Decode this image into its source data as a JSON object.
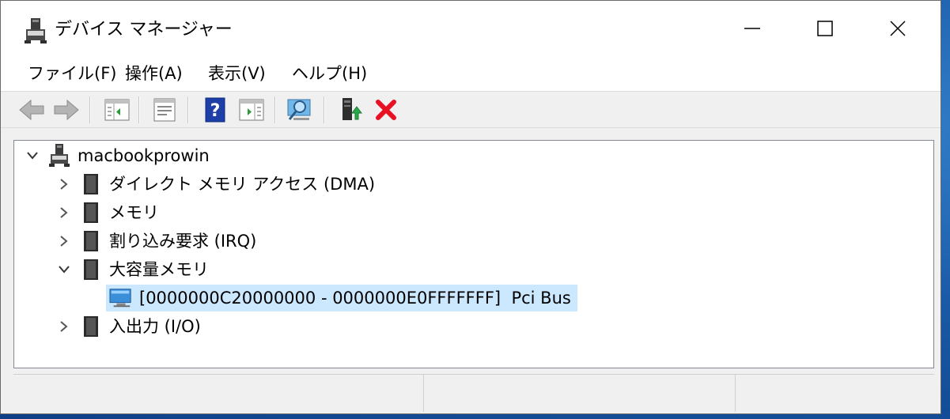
{
  "window": {
    "title": "デバイス マネージャー",
    "icon": "computer-icon"
  },
  "caption_buttons": {
    "minimize": "minimize-icon",
    "maximize": "maximize-icon",
    "close": "close-icon"
  },
  "menu": {
    "file": "ファイル(F)",
    "action": "操作(A)",
    "view": "表示(V)",
    "help": "ヘルプ(H)"
  },
  "toolbar": {
    "buttons": [
      "back-icon",
      "forward-icon",
      "show-hide-console-tree-icon",
      "properties-icon",
      "help-icon",
      "show-action-pane-icon",
      "scan-hardware-icon",
      "update-driver-icon",
      "uninstall-icon"
    ],
    "colors": {
      "uninstall_red": "#e81123",
      "help_blue": "#1e3fa8",
      "update_green": "#2aa84a"
    }
  },
  "tree": {
    "root": "macbookprowin",
    "items": [
      {
        "label": "ダイレクト メモリ アクセス (DMA)",
        "expanded": false
      },
      {
        "label": "メモリ",
        "expanded": false
      },
      {
        "label": "割り込み要求 (IRQ)",
        "expanded": false
      },
      {
        "label": "大容量メモリ",
        "expanded": true
      },
      {
        "label": "[0000000C20000000 - 0000000E0FFFFFFF]  Pci Bus",
        "selected": true
      },
      {
        "label": "入出力 (I/O)",
        "expanded": false
      }
    ],
    "selection_color": "#cce8ff"
  }
}
